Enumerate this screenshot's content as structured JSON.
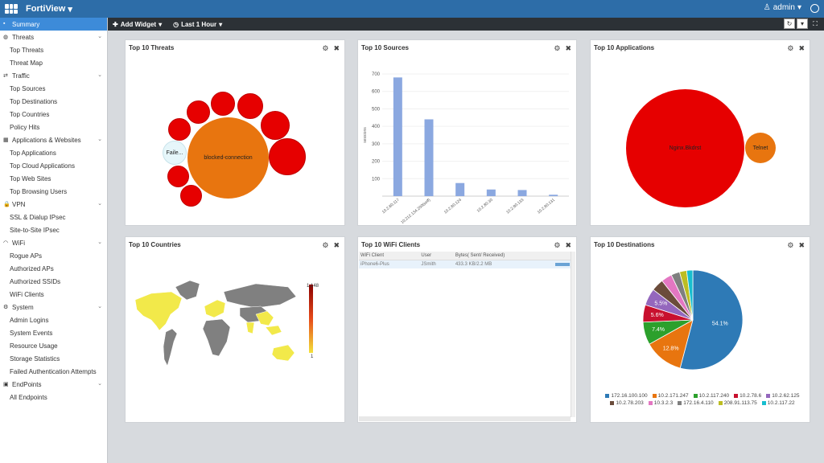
{
  "header": {
    "app_title": "FortiView",
    "user": "admin"
  },
  "toolbar": {
    "add_widget": "Add Widget",
    "time_range": "Last 1 Hour"
  },
  "sidebar": {
    "items": [
      {
        "label": "Summary",
        "type": "active"
      },
      {
        "label": "Threats",
        "type": "section"
      },
      {
        "label": "Top Threats",
        "type": "item"
      },
      {
        "label": "Threat Map",
        "type": "item"
      },
      {
        "label": "Traffic",
        "type": "section"
      },
      {
        "label": "Top Sources",
        "type": "item"
      },
      {
        "label": "Top Destinations",
        "type": "item"
      },
      {
        "label": "Top Countries",
        "type": "item"
      },
      {
        "label": "Policy Hits",
        "type": "item"
      },
      {
        "label": "Applications & Websites",
        "type": "section"
      },
      {
        "label": "Top Applications",
        "type": "item"
      },
      {
        "label": "Top Cloud Applications",
        "type": "item"
      },
      {
        "label": "Top Web Sites",
        "type": "item"
      },
      {
        "label": "Top Browsing Users",
        "type": "item"
      },
      {
        "label": "VPN",
        "type": "section"
      },
      {
        "label": "SSL & Dialup IPsec",
        "type": "item"
      },
      {
        "label": "Site-to-Site IPsec",
        "type": "item"
      },
      {
        "label": "WiFi",
        "type": "section"
      },
      {
        "label": "Rogue APs",
        "type": "item"
      },
      {
        "label": "Authorized APs",
        "type": "item"
      },
      {
        "label": "Authorized SSIDs",
        "type": "item"
      },
      {
        "label": "WiFi Clients",
        "type": "item"
      },
      {
        "label": "System",
        "type": "section"
      },
      {
        "label": "Admin Logins",
        "type": "item"
      },
      {
        "label": "System Events",
        "type": "item"
      },
      {
        "label": "Resource Usage",
        "type": "item"
      },
      {
        "label": "Storage Statistics",
        "type": "item"
      },
      {
        "label": "Failed Authentication Attempts",
        "type": "item"
      },
      {
        "label": "EndPoints",
        "type": "section"
      },
      {
        "label": "All Endpoints",
        "type": "item"
      }
    ]
  },
  "widgets": {
    "threats": {
      "title": "Top 10 Threats",
      "center_label": "blocked-connection",
      "side_label": "Faile..."
    },
    "sources": {
      "title": "Top 10 Sources"
    },
    "applications": {
      "title": "Top 10 Applications",
      "big_label": "Nginx.Bkdrst",
      "small_label": "Telnet"
    },
    "countries": {
      "title": "Top 10 Countries",
      "scale_max": "1,148",
      "scale_min": "1"
    },
    "wifi": {
      "title": "Top 10 WiFi Clients",
      "columns": [
        "WiFi Client",
        "User",
        "Bytes( Sent/ Received)"
      ],
      "rows": [
        [
          "iPhone6-Plus",
          "JSmith",
          "433.3 KB/2.2 MB"
        ]
      ]
    },
    "destinations": {
      "title": "Top 10 Destinations"
    }
  },
  "chart_data": [
    {
      "type": "bar",
      "title": "Top 10 Sources",
      "ylabel": "sessions",
      "categories": [
        "10.2.80.117",
        "10.212.134.200(self)",
        "10.2.80.124",
        "10.2.80.30",
        "10.2.80.133",
        "10.2.80.131"
      ],
      "values": [
        680,
        440,
        75,
        38,
        35,
        8
      ],
      "ylim": [
        0,
        700
      ],
      "yticks": [
        100,
        200,
        300,
        400,
        500,
        600,
        700
      ]
    },
    {
      "type": "pie",
      "title": "Top 10 Destinations",
      "labels": [
        "172.16.100.100",
        "10.2.171.247",
        "10.2.117.240",
        "10.2.78.6",
        "10.2.62.125",
        "10.2.78.203",
        "10.3.2.3",
        "172.16.4.110",
        "208.91.113.75",
        "10.2.117.22"
      ],
      "values": [
        54.1,
        12.8,
        7.4,
        5.6,
        5.5,
        4.0,
        3.5,
        2.8,
        2.3,
        2.0
      ],
      "data_labels": [
        "54.1%",
        "12.8%",
        "7.4%",
        "5.6%",
        "5.5%"
      ],
      "colors": [
        "#2e7ab6",
        "#e8750f",
        "#2ca02c",
        "#c8102e",
        "#9467bd",
        "#6b4c3b",
        "#e377c2",
        "#7f7f7f",
        "#bcbd22",
        "#17becf"
      ]
    }
  ]
}
